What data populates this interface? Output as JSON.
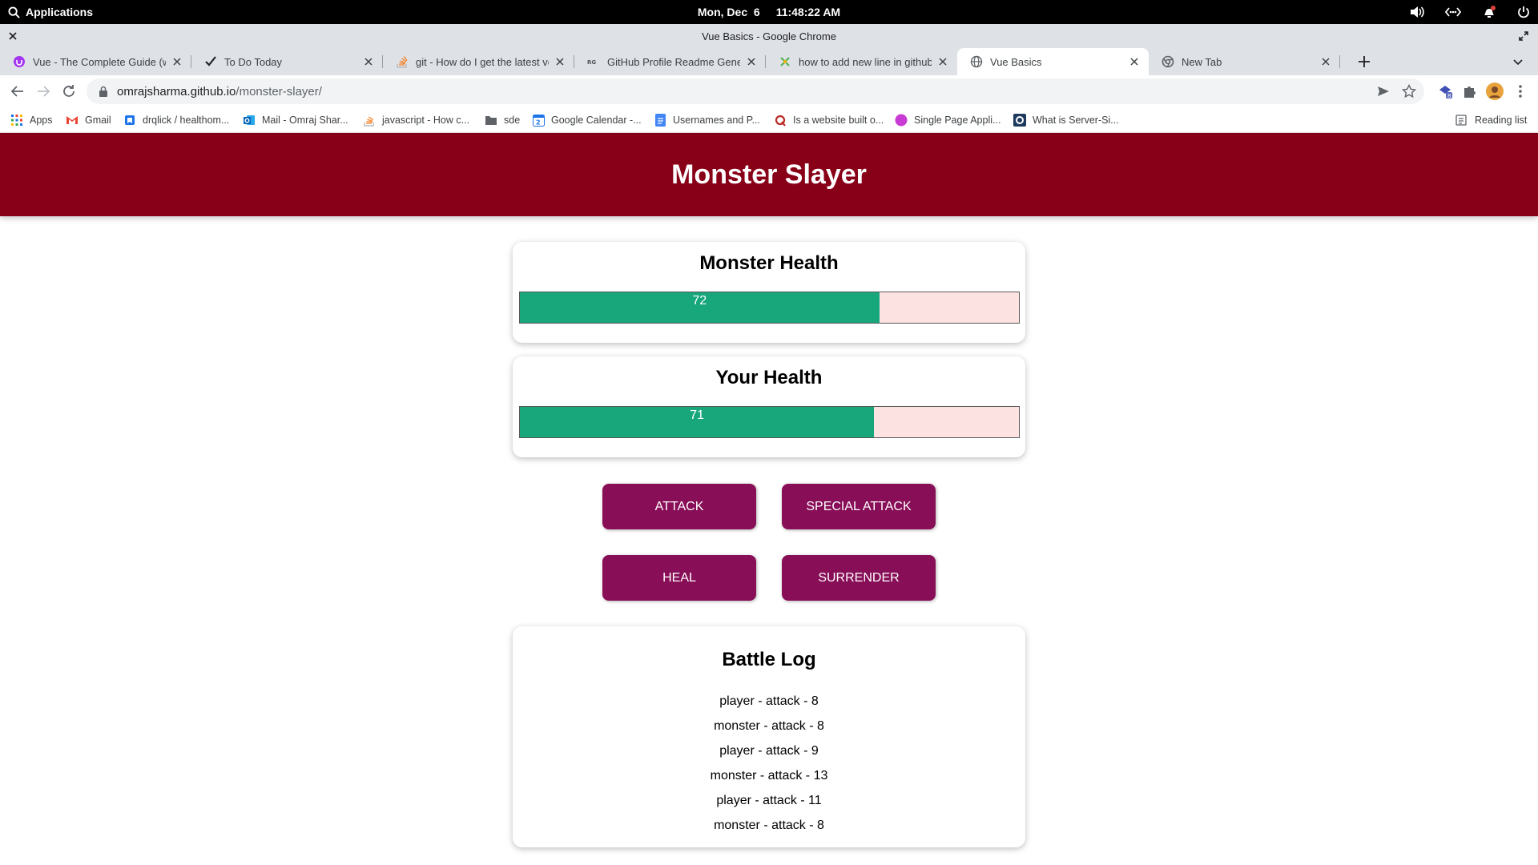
{
  "system": {
    "applications_label": "Applications",
    "date": "Mon, Dec  6",
    "time": "11:48:22 AM"
  },
  "window": {
    "title": "Vue Basics - Google Chrome"
  },
  "tabs": [
    {
      "label": "Vue - The Complete Guide (w/ Router, Vuex, Composition API)",
      "favicon": "udemy-icon",
      "active": false
    },
    {
      "label": "To Do Today",
      "favicon": "checkmark-icon",
      "active": false
    },
    {
      "label": "git - How do I get the latest version",
      "favicon": "stackoverflow-icon",
      "active": false
    },
    {
      "label": "GitHub Profile Readme Generator",
      "favicon": "readme-icon",
      "active": false
    },
    {
      "label": "how to add new line in github readme",
      "favicon": "star-icon",
      "active": false
    },
    {
      "label": "Vue Basics",
      "favicon": "globe-icon",
      "active": true
    },
    {
      "label": "New Tab",
      "favicon": "chrome-icon",
      "active": false
    }
  ],
  "address_bar": {
    "host": "omrajsharma.github.io",
    "path": "/monster-slayer/"
  },
  "bookmarks": [
    {
      "label": "Apps",
      "icon": "apps-grid-icon"
    },
    {
      "label": "Gmail",
      "icon": "gmail-icon"
    },
    {
      "label": "drqlick / healthom...",
      "icon": "bookmark-icon"
    },
    {
      "label": "Mail - Omraj Shar...",
      "icon": "outlook-icon"
    },
    {
      "label": "javascript - How c...",
      "icon": "stackoverflow-icon"
    },
    {
      "label": "sde",
      "icon": "folder-icon"
    },
    {
      "label": "Google Calendar -...",
      "icon": "calendar-icon"
    },
    {
      "label": "Usernames and P...",
      "icon": "docs-icon"
    },
    {
      "label": "Is a website built o...",
      "icon": "quora-icon"
    },
    {
      "label": "Single Page Appli...",
      "icon": "dot-icon"
    },
    {
      "label": "What is Server-Si...",
      "icon": "site-icon"
    }
  ],
  "reading_list_label": "Reading list",
  "game": {
    "title": "Monster Slayer",
    "monster_health": {
      "heading": "Monster Health",
      "value": 72,
      "percent": 72
    },
    "player_health": {
      "heading": "Your Health",
      "value": 71,
      "percent": 71
    },
    "buttons": {
      "attack": "ATTACK",
      "special_attack": "SPECIAL ATTACK",
      "heal": "HEAL",
      "surrender": "SURRENDER"
    },
    "battle_log": {
      "heading": "Battle Log",
      "entries": [
        "player - attack - 8",
        "monster - attack - 8",
        "player - attack - 9",
        "monster - attack - 13",
        "player - attack - 11",
        "monster - attack - 8"
      ]
    }
  },
  "colors": {
    "header_bg": "#880017",
    "button_bg": "#880e57",
    "health_fill": "#17a77b",
    "health_track": "#fde2e2"
  }
}
